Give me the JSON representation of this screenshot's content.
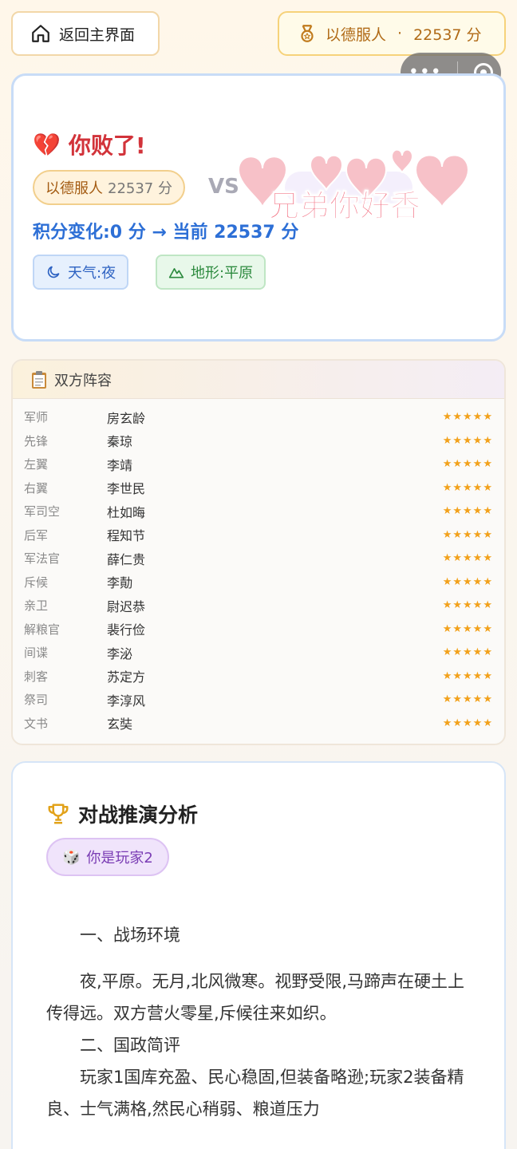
{
  "header": {
    "home_label": "返回主界面",
    "player_name": "以德服人",
    "separator": "·",
    "score": "22537 分"
  },
  "result": {
    "heart_glyph": "💔",
    "title": "你败了!",
    "player_name": "以德服人",
    "player_score": "22537 分",
    "vs": "VS",
    "sticker": "兄弟你好香",
    "score_change": "积分变化:0 分 → 当前 22537 分",
    "weather": "天气:夜",
    "terrain": "地形:平原"
  },
  "lineup": {
    "title": "双方阵容",
    "stars": "★★★★★",
    "rows": [
      {
        "role": "军师",
        "general": "房玄龄"
      },
      {
        "role": "先锋",
        "general": "秦琼"
      },
      {
        "role": "左翼",
        "general": "李靖"
      },
      {
        "role": "右翼",
        "general": "李世民"
      },
      {
        "role": "军司空",
        "general": "杜如晦"
      },
      {
        "role": "后军",
        "general": "程知节"
      },
      {
        "role": "军法官",
        "general": "薛仁贵"
      },
      {
        "role": "斥候",
        "general": "李勣"
      },
      {
        "role": "亲卫",
        "general": "尉迟恭"
      },
      {
        "role": "解粮官",
        "general": "裴行俭"
      },
      {
        "role": "间谍",
        "general": "李泌"
      },
      {
        "role": "刺客",
        "general": "苏定方"
      },
      {
        "role": "祭司",
        "general": "李淳风"
      },
      {
        "role": "文书",
        "general": "玄奘"
      }
    ]
  },
  "analysis": {
    "title": "对战推演分析",
    "you_label": "你是玩家2",
    "dice_glyph": "🎲",
    "section1_heading": "一、战场环境",
    "section1_text": "夜,平原。无月,北风微寒。视野受限,马蹄声在硬土上传得远。双方营火零星,斥候往来如织。",
    "section2_heading": "二、国政简评",
    "section2_text": "玩家1国库充盈、民心稳固,但装备略逊;玩家2装备精良、士气满格,然民心稍弱、粮道压力"
  },
  "colors": {
    "lose_red": "#d2333a",
    "score_blue": "#2d6fd6",
    "gold": "#b06a16",
    "star": "#f2a11b"
  }
}
